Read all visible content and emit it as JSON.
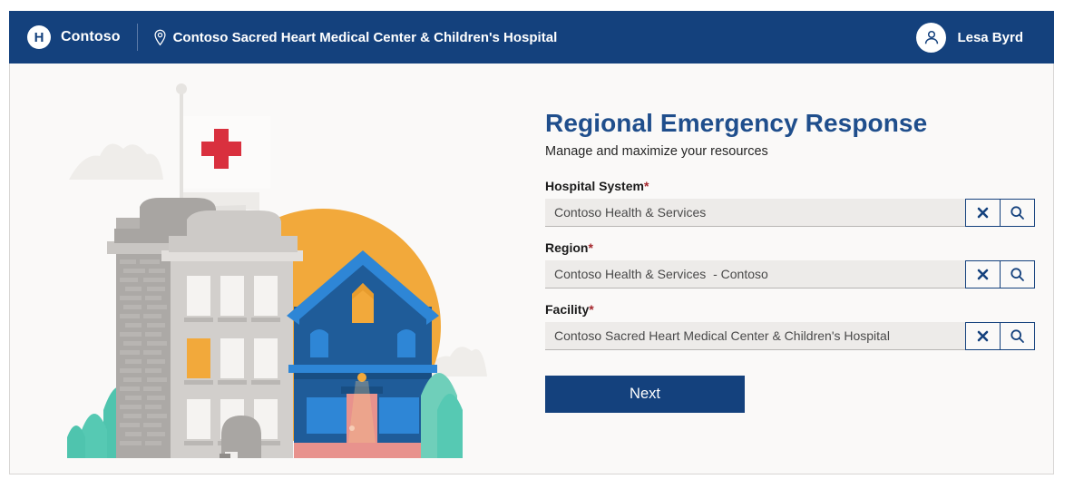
{
  "header": {
    "logo_letter": "H",
    "brand_name": "Contoso",
    "facility_name": "Contoso Sacred Heart Medical Center & Children's Hospital",
    "pin_icon": "location-pin-icon",
    "user_icon": "person-avatar-icon",
    "user_name": "Lesa Byrd"
  },
  "main": {
    "title": "Regional Emergency Response",
    "subtitle": "Manage and maximize your resources",
    "fields": [
      {
        "label": "Hospital System",
        "required_mark": "*",
        "value": "Contoso Health & Services",
        "placeholder": "",
        "clear_icon": "clear-x-icon",
        "search_icon": "search-icon"
      },
      {
        "label": "Region",
        "required_mark": "*",
        "value": "Contoso Health & Services  - Contoso",
        "placeholder": "",
        "clear_icon": "clear-x-icon",
        "search_icon": "search-icon"
      },
      {
        "label": "Facility",
        "required_mark": "*",
        "value": "Contoso Sacred Heart Medical Center & Children's Hospital",
        "placeholder": "",
        "clear_icon": "clear-x-icon",
        "search_icon": "search-icon"
      }
    ],
    "next_label": "Next"
  },
  "colors": {
    "brand_blue": "#14417D",
    "title_blue": "#1F4E8C",
    "page_background": "#FAF9F8",
    "field_background": "#EDEBE9",
    "required_red": "#a4262c",
    "sun_orange": "#F2A93B",
    "house_blue": "#1F5C99",
    "tree_teal": "#3FBFA8",
    "cross_red": "#D9303E",
    "door_pink": "#E8928D"
  },
  "illustration": {
    "name": "hospital-buildings-illustration",
    "elements": [
      "sun",
      "clouds",
      "red-cross-flag",
      "grey-hospital-building",
      "blue-house",
      "teal-trees",
      "entrance-stairs"
    ]
  }
}
